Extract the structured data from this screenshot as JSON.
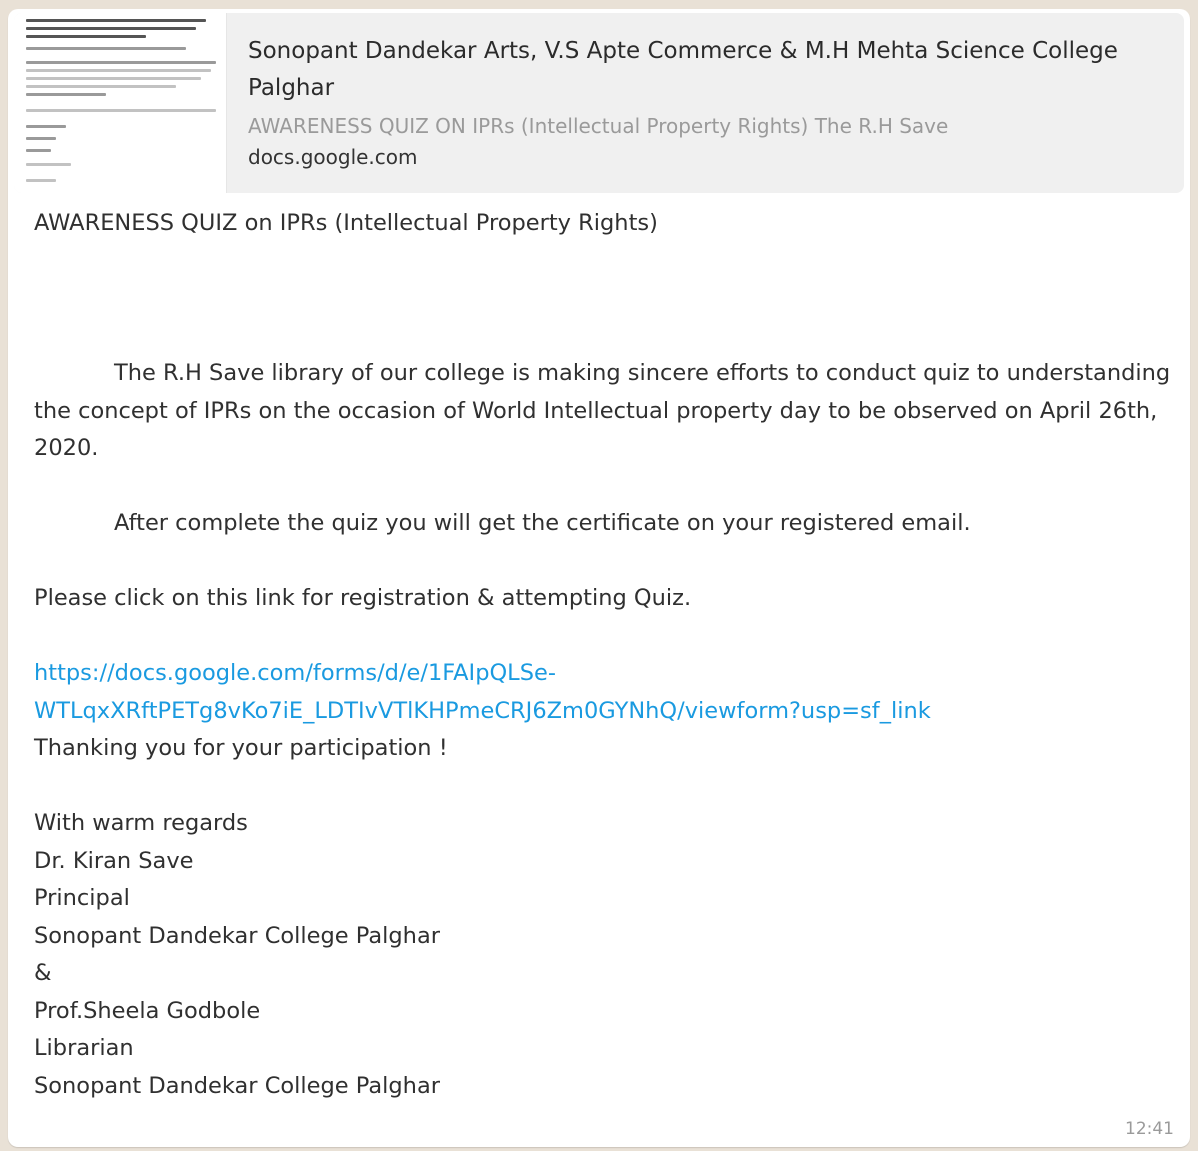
{
  "link_preview": {
    "title": "Sonopant Dandekar Arts, V.S Apte Commerce & M.H Mehta Science College Palghar",
    "description": "AWARENESS QUIZ ON IPRs (Intellectual Property Rights) The R.H Save",
    "domain": "docs.google.com"
  },
  "message": {
    "heading": "AWARENESS QUIZ on IPRs (Intellectual Property Rights)",
    "paragraph1": "The R.H Save library of our college is making sincere efforts to conduct quiz to understanding the concept of IPRs on the occasion of  World Intellectual property day to be observed on April 26th, 2020.",
    "paragraph2": "After complete the quiz you will get the certificate on your registered email.",
    "instruction": "Please click on this link for registration & attempting Quiz.",
    "link": "https://docs.google.com/forms/d/e/1FAIpQLSe-\nWTLqxXRftPETg8vKo7iE_LDTIvVTlKHPmeCRJ6Zm0GYNhQ/viewform?usp=sf_link",
    "thanks": "Thanking you for your participation !",
    "signature": [
      "With warm regards",
      "Dr. Kiran Save",
      "Principal",
      "Sonopant Dandekar College Palghar",
      "&",
      "Prof.Sheela Godbole",
      "Librarian",
      "Sonopant Dandekar College Palghar"
    ]
  },
  "timestamp": "12:41",
  "colors": {
    "link": "#1a9ae0",
    "bubble": "#ffffff",
    "background": "#e9e1d6",
    "preview_bg": "#f0f0f0"
  }
}
